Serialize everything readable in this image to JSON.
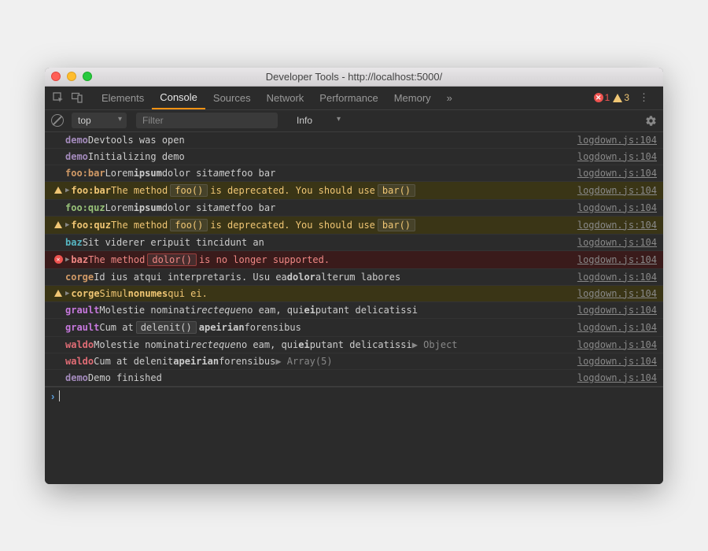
{
  "window": {
    "title": "Developer Tools - http://localhost:5000/"
  },
  "tabs": {
    "items": [
      "Elements",
      "Console",
      "Sources",
      "Network",
      "Performance",
      "Memory"
    ],
    "active": "Console",
    "overflow": "»"
  },
  "status": {
    "errors": 1,
    "warnings": 3
  },
  "filterbar": {
    "context": "top",
    "filter_placeholder": "Filter",
    "level": "Info"
  },
  "logs": [
    {
      "type": "log",
      "ns": "demo",
      "nsclass": "demo",
      "segments": [
        {
          "t": "Devtools was open"
        }
      ],
      "source": "logdown.js:104"
    },
    {
      "type": "log",
      "ns": "demo",
      "nsclass": "demo",
      "segments": [
        {
          "t": "Initializing demo"
        }
      ],
      "source": "logdown.js:104"
    },
    {
      "type": "log",
      "ns": "foo:bar",
      "nsclass": "foobar",
      "segments": [
        {
          "t": "Lorem "
        },
        {
          "t": "ipsum",
          "b": true
        },
        {
          "t": " dolor sit "
        },
        {
          "t": "amet",
          "i": true
        },
        {
          "t": " foo bar"
        }
      ],
      "source": "logdown.js:104"
    },
    {
      "type": "warning",
      "ns": "foo:bar",
      "nsclass": "foobar",
      "expand": true,
      "segments": [
        {
          "t": "The method "
        },
        {
          "t": "foo()",
          "code": true
        },
        {
          "t": " is deprecated. You should use "
        },
        {
          "t": "bar()",
          "code": true
        }
      ],
      "source": "logdown.js:104"
    },
    {
      "type": "log",
      "ns": "foo:quz",
      "nsclass": "fooquz",
      "segments": [
        {
          "t": "Lorem "
        },
        {
          "t": "ipsum",
          "b": true
        },
        {
          "t": " dolor sit "
        },
        {
          "t": "amet",
          "i": true
        },
        {
          "t": " foo bar"
        }
      ],
      "source": "logdown.js:104"
    },
    {
      "type": "warning",
      "ns": "foo:quz",
      "nsclass": "fooquz",
      "expand": true,
      "segments": [
        {
          "t": "The method "
        },
        {
          "t": "foo()",
          "code": true
        },
        {
          "t": " is deprecated. You should use "
        },
        {
          "t": "bar()",
          "code": true
        }
      ],
      "source": "logdown.js:104"
    },
    {
      "type": "log",
      "ns": "baz",
      "nsclass": "baz",
      "segments": [
        {
          "t": "Sit viderer eripuit tincidunt an"
        }
      ],
      "source": "logdown.js:104"
    },
    {
      "type": "error",
      "ns": "baz",
      "nsclass": "baz",
      "expand": true,
      "segments": [
        {
          "t": "The method "
        },
        {
          "t": "dolor()",
          "code": true
        },
        {
          "t": " is no longer supported."
        }
      ],
      "source": "logdown.js:104"
    },
    {
      "type": "log",
      "ns": "corge",
      "nsclass": "corge",
      "segments": [
        {
          "t": "Id ius atqui interpretaris. Usu ea "
        },
        {
          "t": "dolor",
          "b": true
        },
        {
          "t": " alterum labores"
        }
      ],
      "source": "logdown.js:104"
    },
    {
      "type": "warning",
      "ns": "corge",
      "nsclass": "corge",
      "expand": true,
      "segments": [
        {
          "t": "Simul "
        },
        {
          "t": "nonumes",
          "b": true
        },
        {
          "t": " qui ei."
        }
      ],
      "source": "logdown.js:104"
    },
    {
      "type": "log",
      "ns": "grault",
      "nsclass": "grault",
      "segments": [
        {
          "t": "Molestie nominati "
        },
        {
          "t": "recteque",
          "i": true
        },
        {
          "t": " no eam, qui "
        },
        {
          "t": "ei",
          "b": true
        },
        {
          "t": " putant delicatissi"
        }
      ],
      "source": "logdown.js:104"
    },
    {
      "type": "log",
      "ns": "grault",
      "nsclass": "grault",
      "segments": [
        {
          "t": "Cum at "
        },
        {
          "t": "delenit()",
          "code": true
        },
        {
          "t": " "
        },
        {
          "t": "apeirian",
          "b": true
        },
        {
          "t": " forensibus"
        }
      ],
      "source": "logdown.js:104"
    },
    {
      "type": "log",
      "ns": "waldo",
      "nsclass": "waldo",
      "segments": [
        {
          "t": "Molestie nominati "
        },
        {
          "t": "recteque",
          "i": true
        },
        {
          "t": " no eam, qui "
        },
        {
          "t": "ei",
          "b": true
        },
        {
          "t": " putant delicatissi "
        },
        {
          "t": "▶ Object",
          "obj": true
        }
      ],
      "source": "logdown.js:104"
    },
    {
      "type": "log",
      "ns": "waldo",
      "nsclass": "waldo",
      "segments": [
        {
          "t": "Cum at delenit "
        },
        {
          "t": "apeirian",
          "b": true
        },
        {
          "t": " forensibus "
        },
        {
          "t": "▶ Array(5)",
          "obj": true
        }
      ],
      "source": "logdown.js:104"
    },
    {
      "type": "log",
      "ns": "demo",
      "nsclass": "demo",
      "segments": [
        {
          "t": "Demo finished"
        }
      ],
      "source": "logdown.js:104"
    }
  ]
}
